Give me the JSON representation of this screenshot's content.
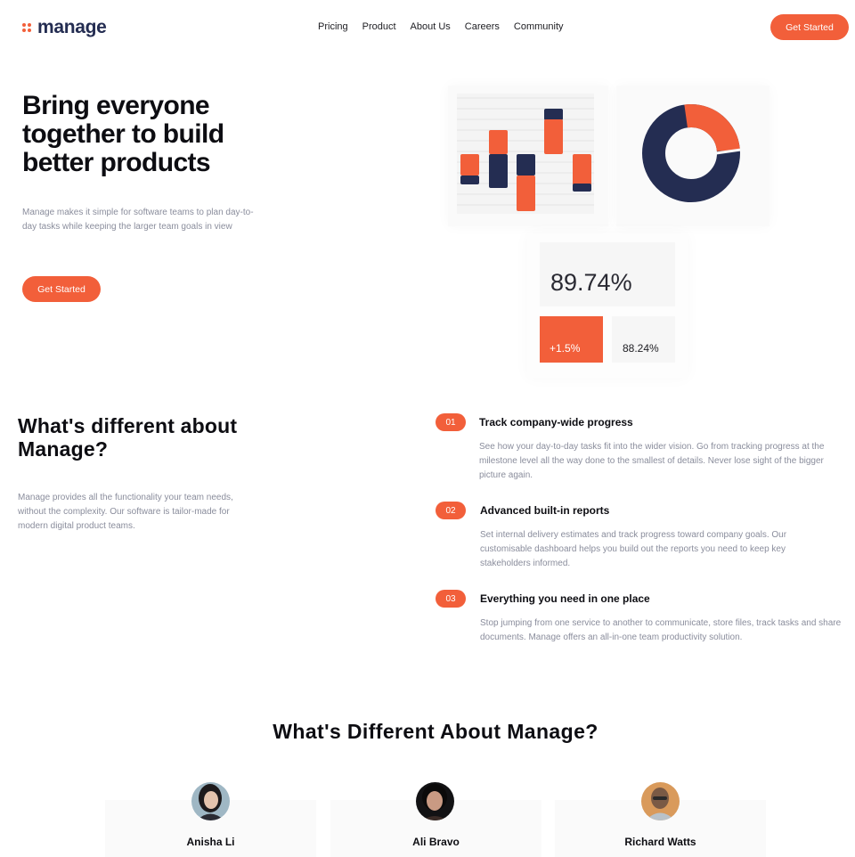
{
  "brand": {
    "name": "manage",
    "accent": "#f25f3a",
    "navy": "#242d52"
  },
  "nav": {
    "items": [
      "Pricing",
      "Product",
      "About Us",
      "Careers",
      "Community"
    ]
  },
  "header": {
    "cta_label": "Get Started"
  },
  "hero": {
    "title": "Bring everyone together to build better products",
    "description": "Manage makes it simple for software teams to plan day-to-day tasks while keeping the larger team goals in view",
    "cta_label": "Get Started"
  },
  "dashboard": {
    "stat_main": "89.74%",
    "stat_change": "+1.5%",
    "stat_secondary": "88.24%",
    "donut_segments": [
      {
        "color": "#f25f3a",
        "fraction": 0.26
      },
      {
        "color": "#242d52",
        "fraction": 0.74
      }
    ]
  },
  "features": {
    "title": "What's different about Manage?",
    "description": "Manage provides all the functionality your team needs, without the complexity. Our software is tailor-made for modern digital product teams.",
    "items": [
      {
        "number": "01",
        "title": "Track company-wide progress",
        "text": "See how your day-to-day tasks fit into the wider vision. Go from tracking progress at the milestone level all the way done to the smallest of details. Never lose sight of the bigger picture again."
      },
      {
        "number": "02",
        "title": "Advanced built-in reports",
        "text": "Set internal delivery estimates and track progress toward company goals. Our customisable dashboard helps you build out the reports you need to keep key stakeholders informed."
      },
      {
        "number": "03",
        "title": "Everything you need in one place",
        "text": "Stop jumping from one service to another to communicate, store files, track tasks and share documents. Manage offers an all-in-one team productivity solution."
      }
    ]
  },
  "testimonials": {
    "title": "What's Different About Manage?",
    "people": [
      {
        "name": "Anisha Li"
      },
      {
        "name": "Ali Bravo"
      },
      {
        "name": "Richard Watts"
      }
    ]
  }
}
